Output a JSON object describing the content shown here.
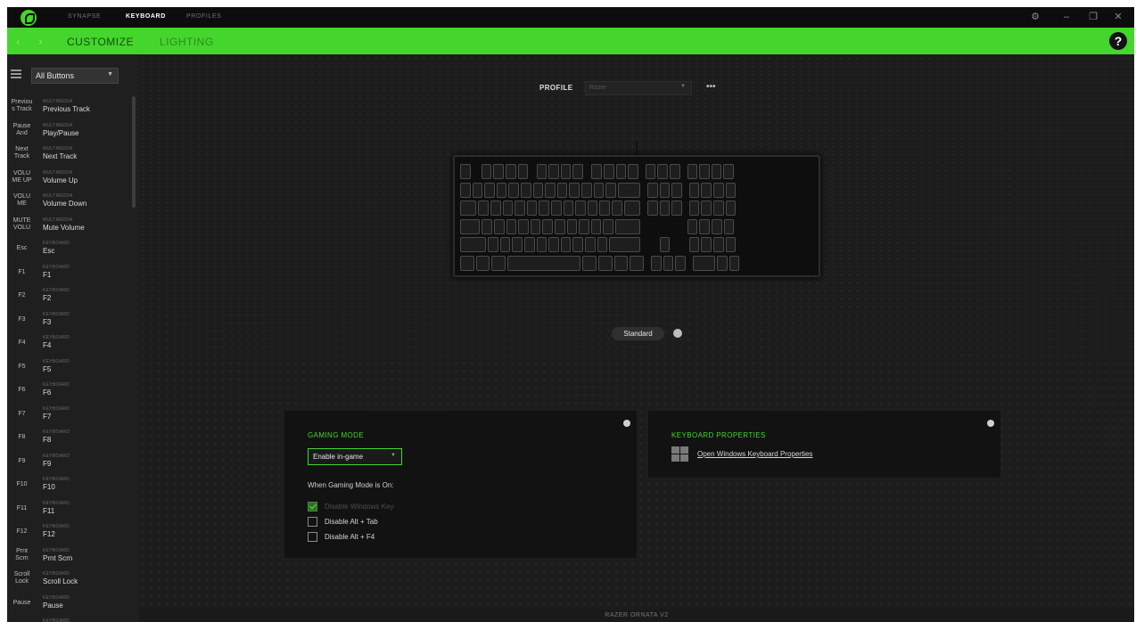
{
  "app": {
    "top_tabs": [
      "SYNAPSE",
      "KEYBOARD",
      "PROFILES"
    ],
    "active_top_tab": "KEYBOARD",
    "window_controls": [
      "⚙",
      "–",
      "❐",
      "✕"
    ]
  },
  "subnav": {
    "back_icon": "chevron-left-icon",
    "forward_icon": "chevron-right-icon",
    "tabs": [
      "CUSTOMIZE",
      "LIGHTING"
    ],
    "active_tab": "CUSTOMIZE",
    "help": "?"
  },
  "sidebar": {
    "filter_value": "All Buttons",
    "items": [
      {
        "key": "Previou\ns Track",
        "type": "MULTIMEDIA",
        "label": "Previous Track"
      },
      {
        "key": "Pause\nAnd",
        "type": "MULTIMEDIA",
        "label": "Play/Pause"
      },
      {
        "key": "Next\nTrack",
        "type": "MULTIMEDIA",
        "label": "Next Track"
      },
      {
        "key": "VOLU\nME UP",
        "type": "MULTIMEDIA",
        "label": "Volume Up"
      },
      {
        "key": "VOLU\nME",
        "type": "MULTIMEDIA",
        "label": "Volume Down"
      },
      {
        "key": "MUTE\nVOLU",
        "type": "MULTIMEDIA",
        "label": "Mute Volume"
      },
      {
        "key": "Esc",
        "type": "KEYBOARD",
        "label": "Esc"
      },
      {
        "key": "F1",
        "type": "KEYBOARD",
        "label": "F1"
      },
      {
        "key": "F2",
        "type": "KEYBOARD",
        "label": "F2"
      },
      {
        "key": "F3",
        "type": "KEYBOARD",
        "label": "F3"
      },
      {
        "key": "F4",
        "type": "KEYBOARD",
        "label": "F4"
      },
      {
        "key": "F5",
        "type": "KEYBOARD",
        "label": "F5"
      },
      {
        "key": "F6",
        "type": "KEYBOARD",
        "label": "F6"
      },
      {
        "key": "F7",
        "type": "KEYBOARD",
        "label": "F7"
      },
      {
        "key": "F8",
        "type": "KEYBOARD",
        "label": "F8"
      },
      {
        "key": "F9",
        "type": "KEYBOARD",
        "label": "F9"
      },
      {
        "key": "F10",
        "type": "KEYBOARD",
        "label": "F10"
      },
      {
        "key": "F11",
        "type": "KEYBOARD",
        "label": "F11"
      },
      {
        "key": "F12",
        "type": "KEYBOARD",
        "label": "F12"
      },
      {
        "key": "Prnt\nScrn",
        "type": "KEYBOARD",
        "label": "Prnt Scrn"
      },
      {
        "key": "Scroll\nLock",
        "type": "KEYBOARD",
        "label": "Scroll Lock"
      },
      {
        "key": "Pause",
        "type": "KEYBOARD",
        "label": "Pause"
      },
      {
        "key": "",
        "type": "KEYBOARD",
        "label": ""
      }
    ]
  },
  "profile": {
    "label": "PROFILE",
    "value": "Razer",
    "more": "•••"
  },
  "layout_mode": {
    "label": "Standard"
  },
  "gaming_mode": {
    "title": "GAMING MODE",
    "select_value": "Enable in-game",
    "subtitle": "When Gaming Mode is On:",
    "options": [
      {
        "label": "Disable Windows Key",
        "checked": true,
        "disabled": true
      },
      {
        "label": "Disable Alt + Tab",
        "checked": false,
        "disabled": false
      },
      {
        "label": "Disable Alt + F4",
        "checked": false,
        "disabled": false
      }
    ]
  },
  "keyboard_properties": {
    "title": "KEYBOARD PROPERTIES",
    "link": "Open Windows Keyboard Properties",
    "icon": "windows-icon"
  },
  "footer": {
    "device_name": "RAZER ORNATA V2"
  },
  "colors": {
    "accent": "#44d62c",
    "background": "#1b1b1b",
    "titlebar": "#0d0d0d"
  }
}
